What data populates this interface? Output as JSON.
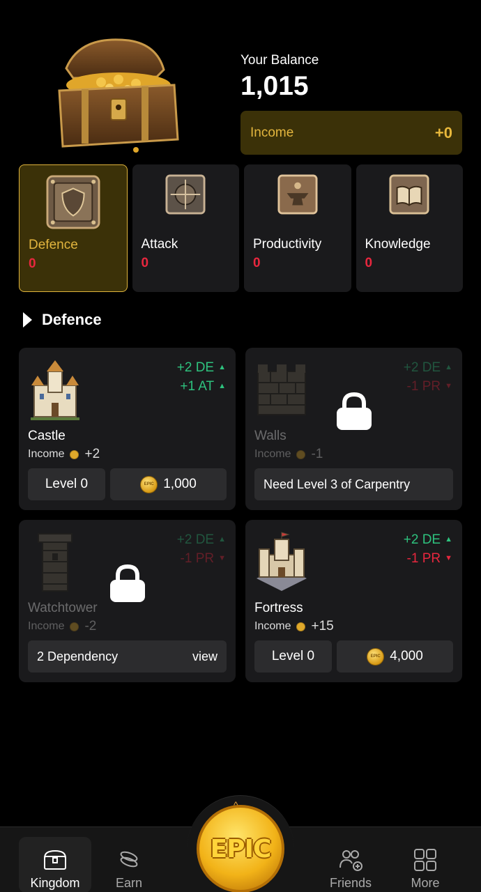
{
  "header": {
    "balance_label": "Your Balance",
    "balance_value": "1,015",
    "income_label": "Income",
    "income_value": "+0"
  },
  "categories": [
    {
      "name": "Defence",
      "count": "0",
      "active": true
    },
    {
      "name": "Attack",
      "count": "0",
      "active": false
    },
    {
      "name": "Productivity",
      "count": "0",
      "active": false
    },
    {
      "name": "Knowledge",
      "count": "0",
      "active": false
    }
  ],
  "section": {
    "title": "Defence"
  },
  "buildings": [
    {
      "name": "Castle",
      "locked": false,
      "bonus": [
        {
          "text": "+2 DE",
          "dir": "up"
        },
        {
          "text": "+1 AT",
          "dir": "up"
        }
      ],
      "income_label": "Income",
      "income_value": "+2",
      "level_label": "Level 0",
      "price": "1,000"
    },
    {
      "name": "Walls",
      "locked": true,
      "bonus": [
        {
          "text": "+2 DE",
          "dir": "up"
        },
        {
          "text": "-1 PR",
          "dir": "down"
        }
      ],
      "income_label": "Income",
      "income_value": "-1",
      "requirement": "Need Level 3 of Carpentry"
    },
    {
      "name": "Watchtower",
      "locked": true,
      "bonus": [
        {
          "text": "+2 DE",
          "dir": "up"
        },
        {
          "text": "-1 PR",
          "dir": "down"
        }
      ],
      "income_label": "Income",
      "income_value": "-2",
      "dependency": "2 Dependency",
      "dependency_action": "view"
    },
    {
      "name": "Fortress",
      "locked": false,
      "bonus": [
        {
          "text": "+2 DE",
          "dir": "up"
        },
        {
          "text": "-1 PR",
          "dir": "down"
        }
      ],
      "income_label": "Income",
      "income_value": "+15",
      "level_label": "Level 0",
      "price": "4,000"
    }
  ],
  "coin_mark": "EPIC",
  "nav": {
    "items": [
      {
        "label": "Kingdom",
        "icon": "chest-icon",
        "active": true
      },
      {
        "label": "Earn",
        "icon": "coins-icon",
        "active": false
      },
      {
        "label": "Friends",
        "icon": "friends-icon",
        "active": false
      },
      {
        "label": "More",
        "icon": "grid-icon",
        "active": false
      }
    ],
    "center_label": "EPIC",
    "caret": "^"
  },
  "colors": {
    "accent_gold": "#e2b53e",
    "income_bg": "#3b3108",
    "positive": "#2ec27e",
    "negative": "#e8273e",
    "card_bg": "#1a1a1c"
  }
}
